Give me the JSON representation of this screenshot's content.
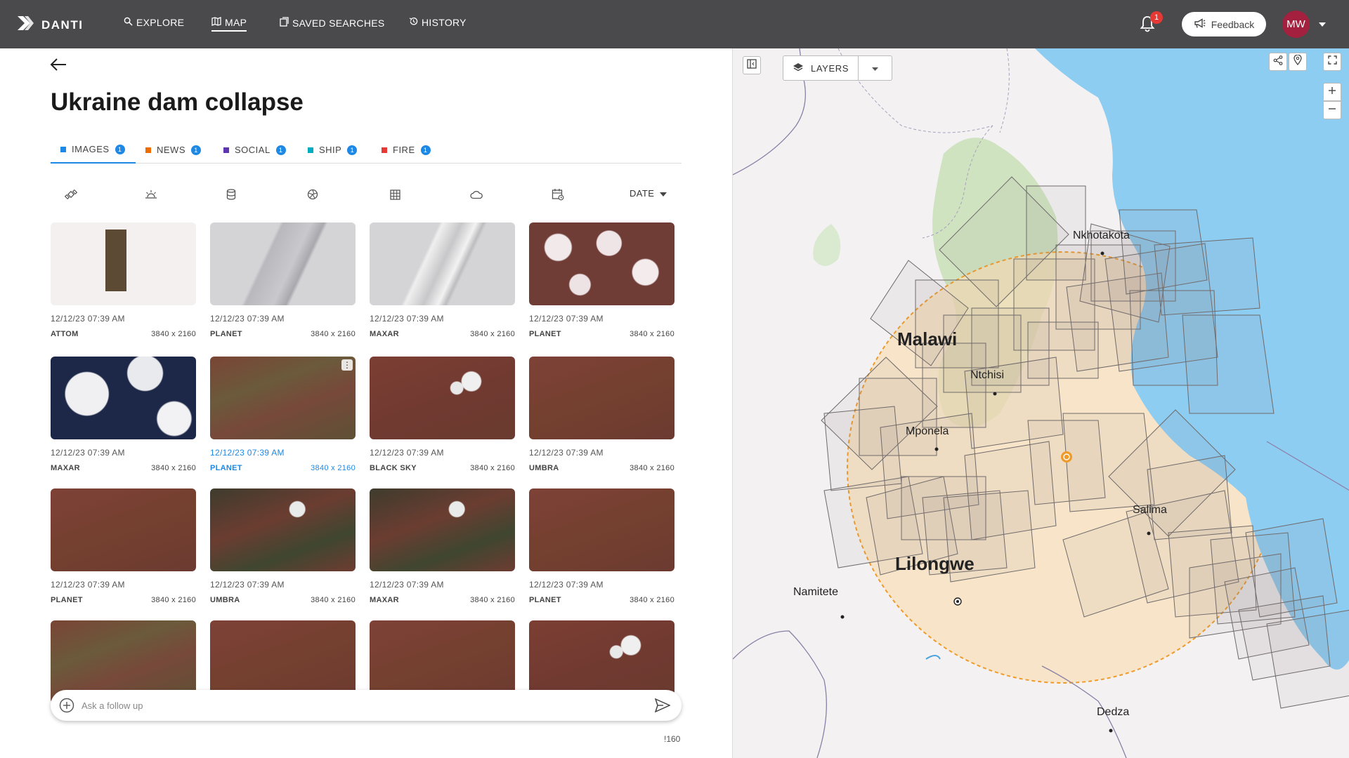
{
  "app": {
    "brand": "DANTI"
  },
  "nav": {
    "items": [
      {
        "label": "EXPLORE",
        "icon": "search-icon"
      },
      {
        "label": "MAP",
        "icon": "map-icon",
        "active": true
      },
      {
        "label": "SAVED SEARCHES",
        "icon": "bookmark-icon"
      },
      {
        "label": "HISTORY",
        "icon": "history-icon"
      }
    ]
  },
  "header": {
    "notifications_count": "1",
    "feedback_label": "Feedback",
    "avatar_initials": "MW"
  },
  "page": {
    "title": "Ukraine dam collapse"
  },
  "tabs": [
    {
      "label": "IMAGES",
      "count": "1",
      "color": "#1e88e5",
      "active": true
    },
    {
      "label": "NEWS",
      "count": "1",
      "color": "#ef6c00"
    },
    {
      "label": "SOCIAL",
      "count": "1",
      "color": "#5e35b1"
    },
    {
      "label": "SHIP",
      "count": "1",
      "color": "#00acc1"
    },
    {
      "label": "FIRE",
      "count": "1",
      "color": "#e53935"
    }
  ],
  "filters": {
    "icons": [
      "satellite-icon",
      "sun-elevation-icon",
      "database-icon",
      "aperture-icon",
      "grid-icon",
      "cloud-icon",
      "calendar-icon"
    ],
    "sort_label": "DATE"
  },
  "results": [
    {
      "date": "12/12/23  07:39 AM",
      "provider": "ATTOM",
      "resolution": "3840 x 2160",
      "style": "parcel"
    },
    {
      "date": "12/12/23  07:39 AM",
      "provider": "PLANET",
      "resolution": "3840 x 2160",
      "style": "strip-gray"
    },
    {
      "date": "12/12/23  07:39 AM",
      "provider": "MAXAR",
      "resolution": "3840 x 2160",
      "style": "strip-cloud"
    },
    {
      "date": "12/12/23  07:39 AM",
      "provider": "PLANET",
      "resolution": "3840 x 2160",
      "style": "snow-brown"
    },
    {
      "date": "12/12/23  07:39 AM",
      "provider": "MAXAR",
      "resolution": "3840 x 2160",
      "style": "clouds-blue"
    },
    {
      "date": "12/12/23  07:39 AM",
      "provider": "PLANET",
      "resolution": "3840 x 2160",
      "style": "terrain-green",
      "selected": true
    },
    {
      "date": "12/12/23  07:39 AM",
      "provider": "BLACK SKY",
      "resolution": "3840 x 2160",
      "style": "terrain-clouds"
    },
    {
      "date": "12/12/23  07:39 AM",
      "provider": "UMBRA",
      "resolution": "3840 x 2160",
      "style": "terrain"
    },
    {
      "date": "12/12/23  07:39 AM",
      "provider": "PLANET",
      "resolution": "3840 x 2160",
      "style": "terrain"
    },
    {
      "date": "12/12/23  07:39 AM",
      "provider": "UMBRA",
      "resolution": "3840 x 2160",
      "style": "terrain-dark"
    },
    {
      "date": "12/12/23  07:39 AM",
      "provider": "MAXAR",
      "resolution": "3840 x 2160",
      "style": "terrain-dark"
    },
    {
      "date": "12/12/23  07:39 AM",
      "provider": "PLANET",
      "resolution": "3840 x 2160",
      "style": "terrain"
    },
    {
      "style": "terrain-green"
    },
    {
      "style": "terrain"
    },
    {
      "style": "terrain"
    },
    {
      "style": "terrain-clouds"
    }
  ],
  "followup": {
    "placeholder": "Ask a follow up"
  },
  "footer_peek": "!160",
  "map": {
    "layers_label": "LAYERS",
    "places": [
      {
        "name": "Nkhotakota",
        "size": "medium"
      },
      {
        "name": "Malawi",
        "size": "country"
      },
      {
        "name": "Ntchisi",
        "size": "medium"
      },
      {
        "name": "Mponela",
        "size": "medium"
      },
      {
        "name": "Salima",
        "size": "medium"
      },
      {
        "name": "Lilongwe",
        "size": "capital"
      },
      {
        "name": "Namitete",
        "size": "medium"
      },
      {
        "name": "Dedza",
        "size": "medium"
      }
    ],
    "colors": {
      "lake": "#8ecdf2",
      "aoi_fill": "#f9dfb8",
      "aoi_stroke": "#ef9b2a",
      "footprint": "#6f6a6a",
      "park": "#cfe3c1"
    }
  }
}
